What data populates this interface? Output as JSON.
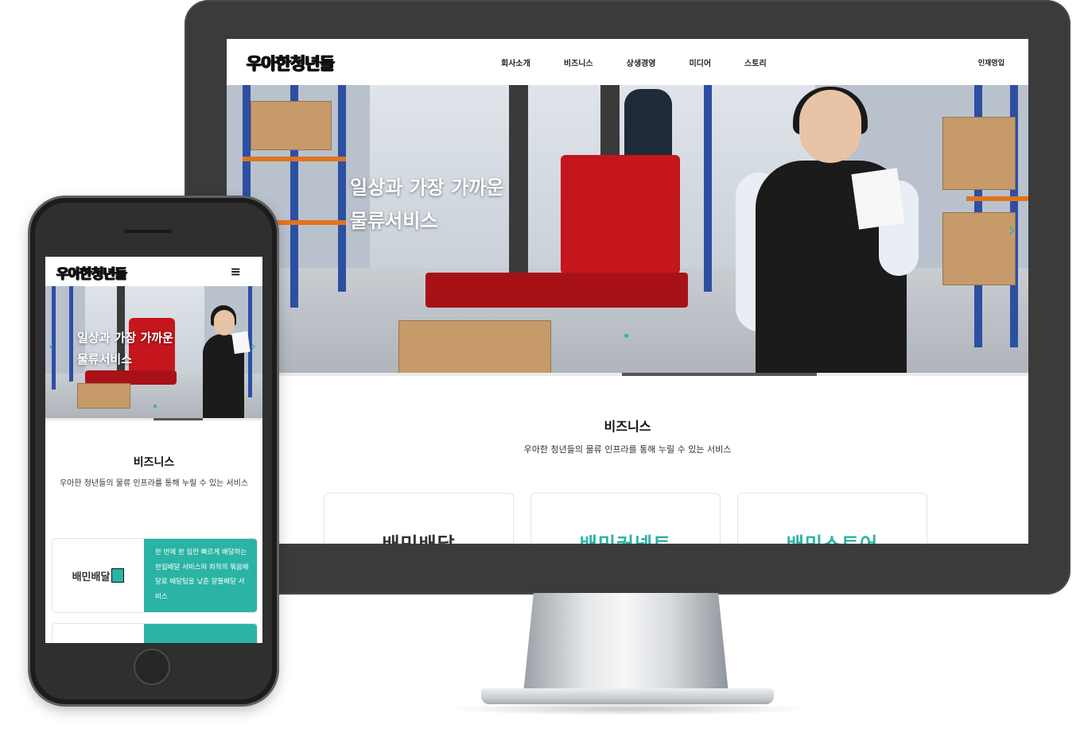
{
  "brand": {
    "logo_text": "우아한청년들",
    "accent_color": "#2bb3a5"
  },
  "desktop": {
    "nav": {
      "items": [
        "회사소개",
        "비즈니스",
        "상생경영",
        "미디어",
        "스토리"
      ],
      "recruit_label": "인재영입"
    },
    "hero": {
      "line1": "일상과 가장 가까운",
      "line2": "물류서비스",
      "arrow_right": "›"
    },
    "business": {
      "title": "비즈니스",
      "subtitle": "우아한 청년들의 물류 인프라를 통해 누릴 수 있는 서비스",
      "cards": [
        {
          "name": "배민배달",
          "color": "#333333"
        },
        {
          "name": "배민커넥트",
          "color": "#2bb3a5"
        },
        {
          "name": "배민스토어",
          "color": "#2bb3a5"
        }
      ]
    }
  },
  "mobile": {
    "menu_icon": "≡",
    "hero": {
      "line1": "일상과 가장 가까운",
      "line2": "물류서비스",
      "arrow_left": "‹",
      "arrow_right": "›"
    },
    "business": {
      "title": "비즈니스",
      "subtitle": "우아한 청년들의 물류 인프라를 통해 누릴 수 있는 서비스",
      "card": {
        "logo": "배민배달",
        "description": "한 번에 한 집만 빠르게 배달하는 한집배달 서비스와 최적의 묶음배달로 배달팁을 낮춘 알뜰배달 서비스"
      }
    }
  }
}
